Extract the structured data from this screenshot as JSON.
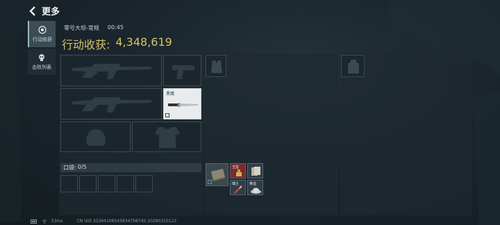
{
  "header": {
    "title": "更多"
  },
  "sidebar": {
    "tabs": [
      {
        "label": "行动收获",
        "icon": "target-icon",
        "active": true
      },
      {
        "label": "击败列表",
        "icon": "skull-icon",
        "active": false
      }
    ]
  },
  "match": {
    "map": "零号大坝-常规",
    "time": "00:45"
  },
  "harvest": {
    "label": "行动收获:",
    "value": "4,348,619"
  },
  "loadout": {
    "primary_weapon_1": {
      "icon": "rifle-icon"
    },
    "sidearm": {
      "icon": "pistol-icon"
    },
    "primary_weapon_2": {
      "icon": "rifle-icon"
    },
    "melee": {
      "label": "黑鹰",
      "icon": "knife-icon"
    },
    "helmet": {
      "icon": "helmet-icon"
    },
    "armor": {
      "icon": "armor-icon"
    },
    "chest_rig": {
      "icon": "chest-rig-icon"
    },
    "backpack": {
      "icon": "backpack-icon"
    }
  },
  "pocket": {
    "label": "口袋:",
    "count": "0/5"
  },
  "backpack_items": [
    {
      "icon": "book-icon",
      "color": "#8a8670"
    },
    {
      "label": "玉玺",
      "icon": "seal-icon",
      "color": "#7a2a2c"
    },
    {
      "icon": "files-icon",
      "color": "#2e3e48"
    },
    {
      "label": "瑞士",
      "icon": "syringe-icon",
      "color": "#2e3e48"
    },
    {
      "label": "奥迪",
      "icon": "cap-icon",
      "color": "#2e3e48"
    }
  ],
  "footer": {
    "ping": "53ms",
    "uid": "CN UID 3539410854383479874S 20280310123"
  },
  "colors": {
    "accent": "#d7c46a",
    "background": "#1a252c",
    "panel": "#1e2a30"
  }
}
